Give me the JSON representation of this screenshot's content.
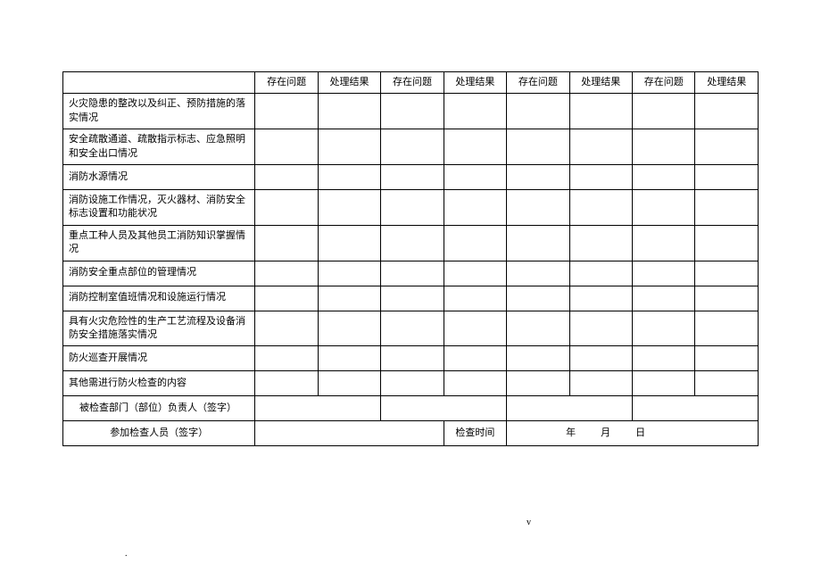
{
  "headers": {
    "problem": "存在问题",
    "result": "处理结果"
  },
  "rows": [
    "火灾隐患的整改以及纠正、预防措施的落实情况",
    "安全疏散通道、疏散指示标志、应急照明和安全出口情况",
    "消防水源情况",
    "消防设施工作情况，灭火器材、消防安全标志设置和功能状况",
    "重点工种人员及其他员工消防知识掌握情况",
    "消防安全重点部位的管理情况",
    "消防控制室值班情况和设施运行情况",
    "具有火灾危险性的生产工艺流程及设备消防安全措施落实情况",
    "防火巡查开展情况",
    "其他需进行防火检查的内容"
  ],
  "signature_rows": {
    "dept_signer": "被检查部门（部位）负责人（签字）",
    "inspectors": "参加检查人员（签字）",
    "inspect_time": "检查时间",
    "date_year": "年",
    "date_month": "月",
    "date_day": "日"
  },
  "footer": {
    "dot": ".",
    "mark": "v"
  }
}
